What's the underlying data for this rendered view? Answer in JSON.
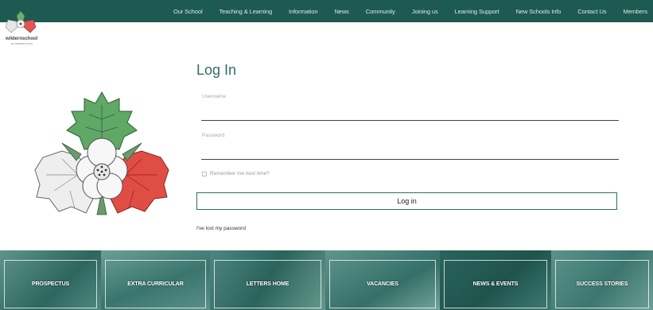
{
  "header": {
    "nav": [
      "Our School",
      "Teaching & Learning",
      "Information",
      "News",
      "Community",
      "Joining us",
      "Learning Support",
      "New Schools Info",
      "Contact Us",
      "Members"
    ]
  },
  "logo": {
    "name": "wildernschool",
    "sub": "an academy trust"
  },
  "login": {
    "title": "Log In",
    "username_label": "Username",
    "password_label": "Password",
    "remember_label": "Remember me next time?",
    "button_label": "Log in",
    "lost_password": "I've lost my password"
  },
  "tiles": [
    {
      "label": "PROSPECTUS",
      "color": "#3f7c74"
    },
    {
      "label": "EXTRA CURRICULAR",
      "color": "#4c8a80"
    },
    {
      "label": "LETTERS HOME",
      "color": "#3a766e"
    },
    {
      "label": "VACANCIES",
      "color": "#4a857c"
    },
    {
      "label": "NEWS & EVENTS",
      "color": "#2f6961"
    },
    {
      "label": "SUCCESS STORIES",
      "color": "#46827a"
    }
  ],
  "colors": {
    "brand": "#1d5a52",
    "accent": "#2f6e64"
  }
}
